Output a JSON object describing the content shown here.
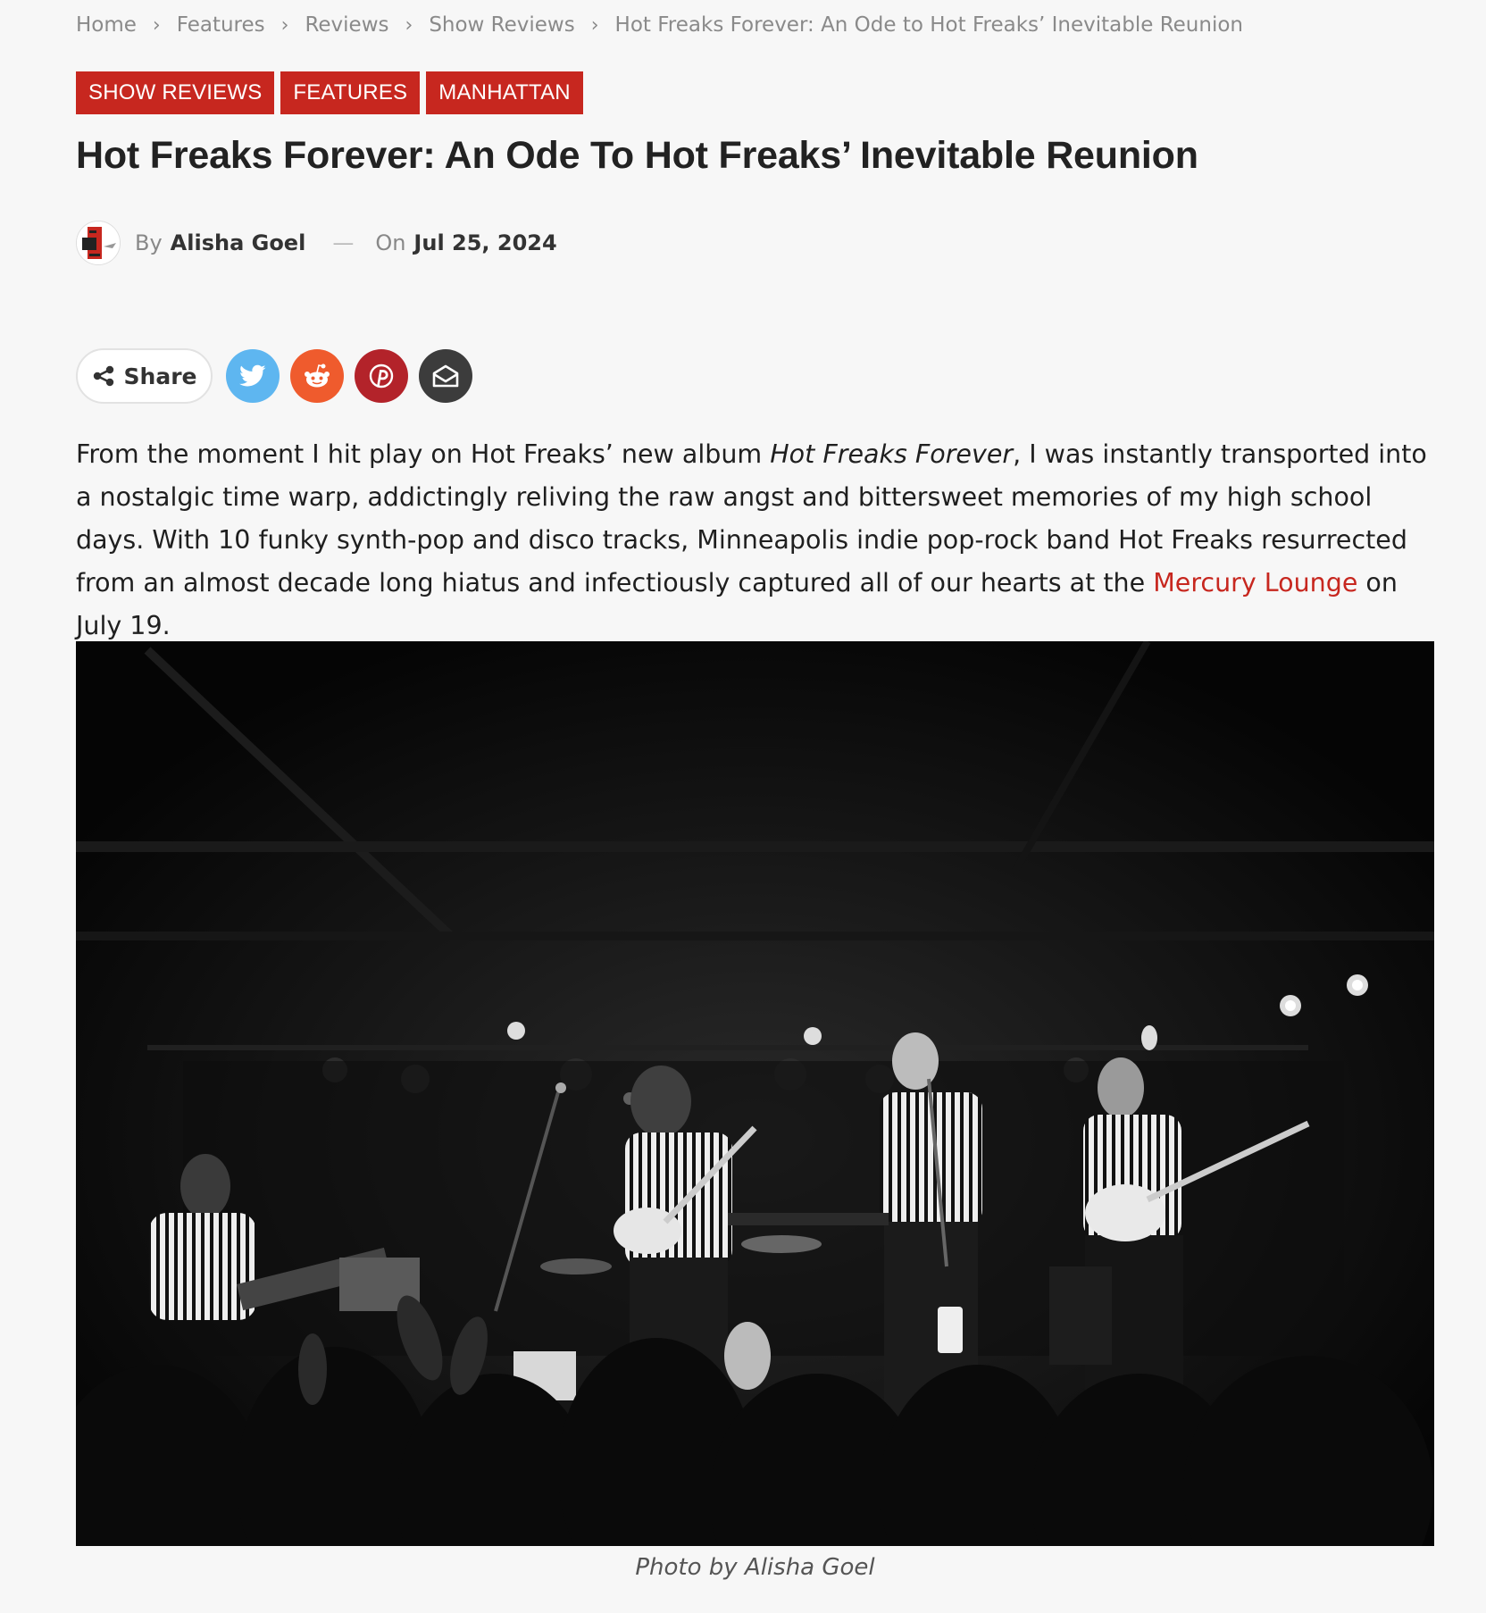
{
  "breadcrumb": {
    "items": [
      "Home",
      "Features",
      "Reviews",
      "Show Reviews"
    ],
    "current": "Hot Freaks Forever: An Ode to Hot Freaks’ Inevitable Reunion"
  },
  "categories": [
    "SHOW REVIEWS",
    "FEATURES",
    "MANHATTAN"
  ],
  "article": {
    "title": "Hot Freaks Forever: An Ode To Hot Freaks’ Inevitable Reunion",
    "by_label": "By",
    "author": "Alisha Goel",
    "date_separator": "—",
    "on_label": "On",
    "date": "Jul 25, 2024"
  },
  "share": {
    "label": "Share",
    "icons": [
      "share-icon",
      "twitter-icon",
      "reddit-icon",
      "pinterest-icon",
      "email-icon"
    ]
  },
  "body": {
    "part1": "From the moment I hit play on Hot Freaks’ new album ",
    "album": "Hot Freaks Forever",
    "part2": ", I was instantly transported into a nostalgic time warp, addictingly reliving the raw angst and bittersweet memories of my high school days. With 10 funky synth-pop and disco tracks, Minneapolis indie pop-rock band Hot Freaks resurrected from an almost decade long hiatus and infectiously captured all of our hearts at the ",
    "venue_link": "Mercury Lounge",
    "part3": " on July 19."
  },
  "photo": {
    "caption": "Photo by Alisha Goel"
  },
  "colors": {
    "accent": "#c7271f",
    "background": "#f7f7f7",
    "twitter": "#5eb6f0",
    "reddit": "#ef5b2d",
    "pinterest": "#b3232a",
    "email": "#3c3c3c"
  }
}
